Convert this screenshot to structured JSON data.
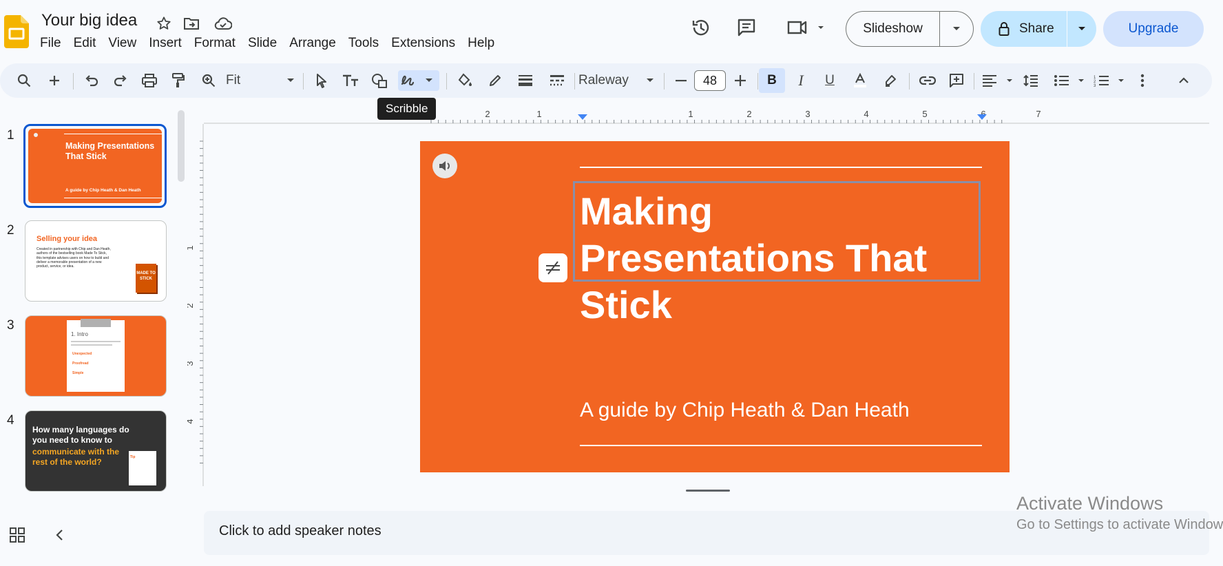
{
  "header": {
    "doc_title": "Your big idea",
    "menus": [
      "File",
      "Edit",
      "View",
      "Insert",
      "Format",
      "Slide",
      "Arrange",
      "Tools",
      "Extensions",
      "Help"
    ],
    "slideshow_label": "Slideshow",
    "share_label": "Share",
    "upgrade_label": "Upgrade"
  },
  "toolbar": {
    "zoom_value": "Fit",
    "font_name": "Raleway",
    "font_size": "48",
    "tooltip": "Scribble"
  },
  "ruler": {
    "horizontal_labels": [
      "2",
      "1",
      "1",
      "2",
      "3",
      "4",
      "5",
      "6",
      "7"
    ],
    "vertical_labels": [
      "1",
      "2",
      "3",
      "4"
    ]
  },
  "filmstrip": {
    "numbers": [
      "1",
      "2",
      "3",
      "4"
    ],
    "slide1": {
      "title": "Making Presentations That Stick",
      "subtitle": "A guide by Chip Heath & Dan Heath"
    },
    "slide2": {
      "title": "Selling your idea",
      "body": "Created in partnership with Chip and Dan Heath, authors of the bestselling book Made To Stick, this template advises users on how to build and deliver a memorable presentation of a new product, service, or idea.",
      "book": "MADE TO STICK"
    },
    "slide3": {
      "title": "1. Intro",
      "items": [
        "Unexpected",
        "Proofread",
        "Simple"
      ]
    },
    "slide4": {
      "line1": "How many languages do you need to know to",
      "line2": "communicate with the rest of the world?",
      "tip": "Tip"
    }
  },
  "slide": {
    "title": "Making Presentations That Stick",
    "subtitle": "A guide by Chip Heath & Dan Heath"
  },
  "notes": {
    "placeholder": "Click to add speaker notes"
  },
  "watermark": {
    "line1": "Activate Windows",
    "line2": "Go to Settings to activate Windows."
  },
  "colors": {
    "accent": "#0b57d0",
    "slide_orange": "#f26522",
    "share_bg": "#c2e7ff",
    "upgrade_bg": "#d3e3fd"
  }
}
